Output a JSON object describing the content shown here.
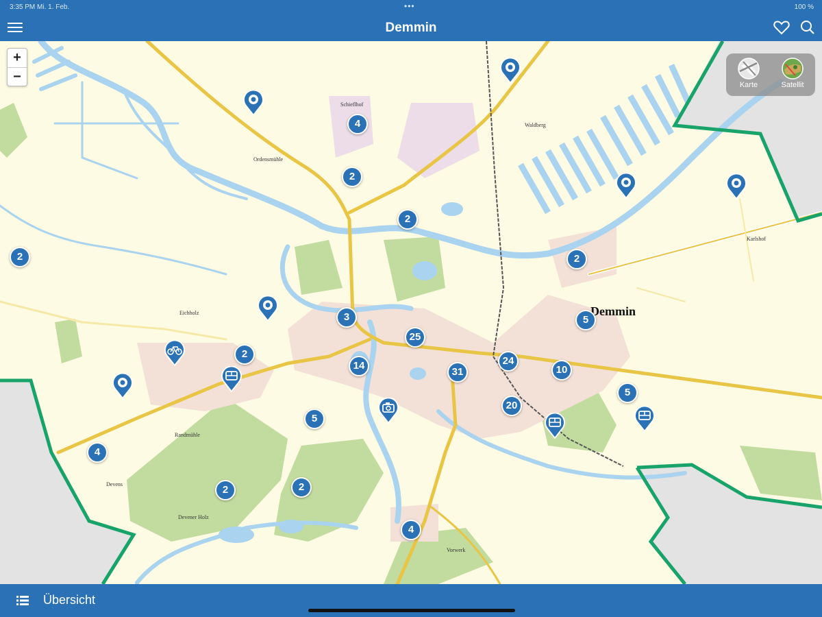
{
  "status_bar": {
    "time": "3:35 PM  Mi. 1. Feb.",
    "battery": "100 %"
  },
  "nav": {
    "title": "Demmin",
    "menu_icon": "menu-icon",
    "favorite_icon": "heart-icon",
    "search_icon": "search-icon"
  },
  "map": {
    "zoom_in": "+",
    "zoom_out": "−",
    "layers": {
      "map_label": "Karte",
      "satellite_label": "Satellit"
    },
    "town_label": "Demmin",
    "place_labels": [
      "Waldberg",
      "Karlshof",
      "Ordensmühle",
      "Devens",
      "Vorwerk",
      "Devener Holz",
      "Eichholz",
      "Randmühle",
      "Schieflhof"
    ],
    "clusters": [
      {
        "count": "4"
      },
      {
        "count": "2"
      },
      {
        "count": "2"
      },
      {
        "count": "2"
      },
      {
        "count": "2"
      },
      {
        "count": "3"
      },
      {
        "count": "25"
      },
      {
        "count": "5"
      },
      {
        "count": "2"
      },
      {
        "count": "14"
      },
      {
        "count": "31"
      },
      {
        "count": "24"
      },
      {
        "count": "10"
      },
      {
        "count": "5"
      },
      {
        "count": "20"
      },
      {
        "count": "5"
      },
      {
        "count": "4"
      },
      {
        "count": "2"
      },
      {
        "count": "2"
      },
      {
        "count": "4"
      }
    ],
    "pins": [
      {
        "icon": "poi-icon"
      },
      {
        "icon": "poi-icon"
      },
      {
        "icon": "poi-icon"
      },
      {
        "icon": "poi-icon"
      },
      {
        "icon": "poi-icon"
      },
      {
        "icon": "poi-icon"
      },
      {
        "icon": "bike-icon"
      },
      {
        "icon": "bus-icon"
      },
      {
        "icon": "camera-icon"
      },
      {
        "icon": "bus-icon"
      },
      {
        "icon": "bus-icon"
      }
    ]
  },
  "bottom": {
    "label": "Übersicht",
    "list_icon": "list-icon"
  },
  "colors": {
    "brand": "#2a72b5",
    "land": "#fdfbe3",
    "water": "#a9d3ef",
    "forest": "#c2dca0",
    "border": "#17a36a",
    "road": "#e8c545"
  }
}
